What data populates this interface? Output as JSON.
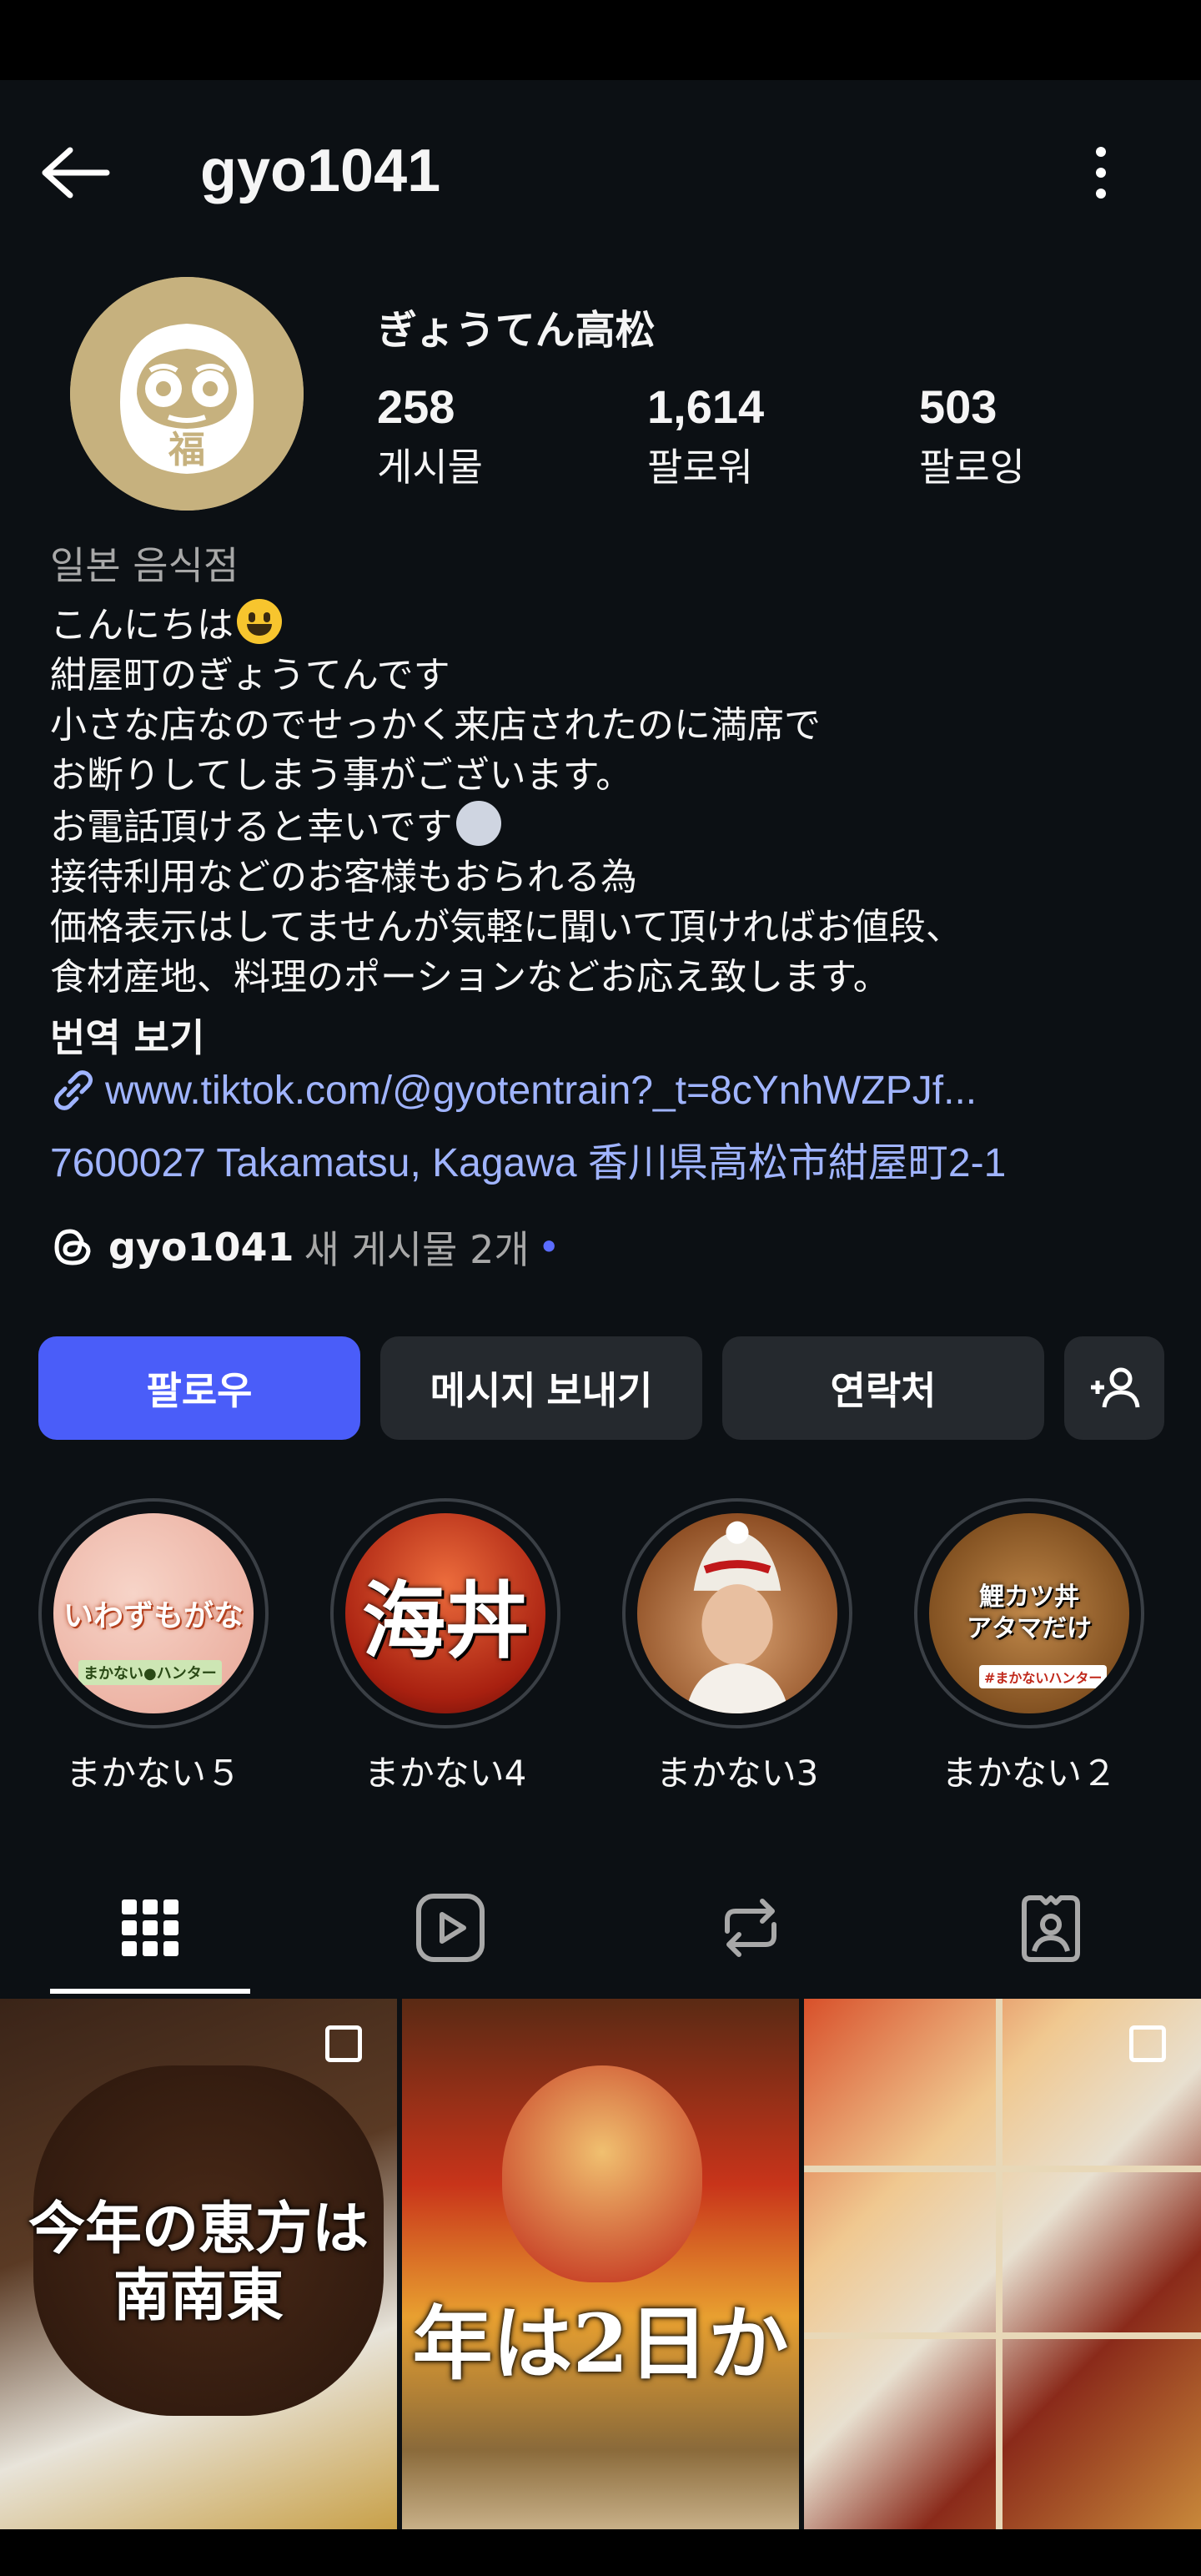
{
  "header": {
    "username": "gyo1041"
  },
  "profile": {
    "display_name": "ぎょうてん高松",
    "stats": [
      {
        "value": "258",
        "label": "게시물"
      },
      {
        "value": "1,614",
        "label": "팔로워"
      },
      {
        "value": "503",
        "label": "팔로잉"
      }
    ],
    "category": "일본 음식점",
    "bio_lines": [
      "こんにちは",
      "紺屋町のぎょうてんです",
      "小さな店なのでせっかく来店されたのに満席で",
      "お断りしてしまう事がございます。",
      "お電話頂けると幸いです",
      "接待利用などのお客様もおられる為",
      "価格表示はしてませんが気軽に聞いて頂ければお値段、",
      "食材産地、料理のポーションなどお応え致します。"
    ],
    "translate_label": "번역 보기",
    "link": "www.tiktok.com/@gyotentrain?_t=8cYnhWZPJf...",
    "address": "7600027 Takamatsu, Kagawa 香川県高松市紺屋町2-1",
    "threads": {
      "handle": "gyo1041",
      "new_posts": "새 게시물 2개",
      "dot": "•"
    }
  },
  "buttons": {
    "follow": "팔로우",
    "message": "메시지 보내기",
    "contact": "연락처"
  },
  "highlights": [
    {
      "label": "まかない５",
      "cover_text": "いわずもがな",
      "sub_text": "まかない●ハンター"
    },
    {
      "label": "まかない4",
      "cover_text": "海丼"
    },
    {
      "label": "まかない3"
    },
    {
      "label": "まかない２",
      "cover_text": "鯉カツ丼\nアタマだけ",
      "sub_text": "#まかないハンター"
    }
  ],
  "tabs": [
    {
      "icon": "grid-icon",
      "active": true
    },
    {
      "icon": "reels-icon",
      "active": false
    },
    {
      "icon": "reposts-icon",
      "active": false
    },
    {
      "icon": "tagged-icon",
      "active": false
    }
  ],
  "posts": [
    {
      "caption": "今年の恵方は\n南南東",
      "multi": true
    },
    {
      "caption": "年は2日か",
      "multi": false
    },
    {
      "caption": "",
      "multi": true
    }
  ]
}
